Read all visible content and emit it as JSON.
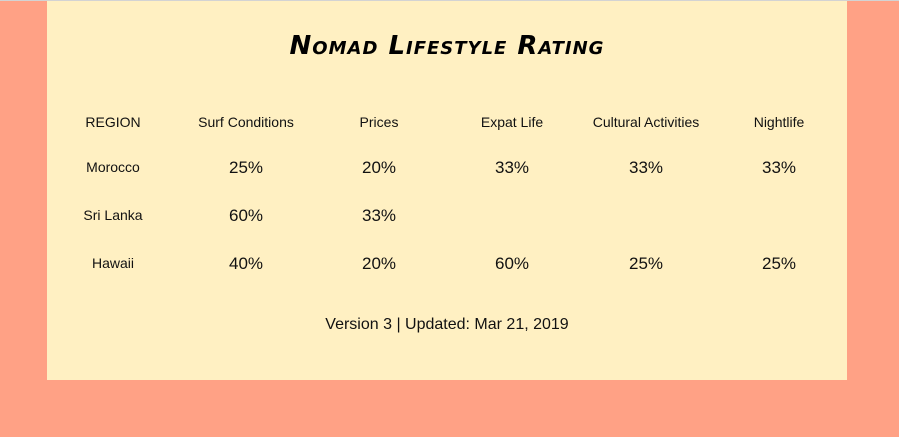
{
  "title": "Nomad Lifestyle Rating",
  "table": {
    "headers": [
      "REGION",
      "Surf Conditions",
      "Prices",
      "Expat Life",
      "Cultural Activities",
      "Nightlife"
    ],
    "rows": [
      {
        "region": "Morocco",
        "values": [
          "25%",
          "20%",
          "33%",
          "33%",
          "33%"
        ]
      },
      {
        "region": "Sri Lanka",
        "values": [
          "60%",
          "33%",
          "",
          "",
          ""
        ]
      },
      {
        "region": "Hawaii",
        "values": [
          "40%",
          "20%",
          "60%",
          "25%",
          "25%"
        ]
      }
    ]
  },
  "footer": "Version 3 | Updated: Mar 21, 2019",
  "colors": {
    "background": "#ffa185",
    "card": "#fff0c2",
    "text": "#111111"
  }
}
